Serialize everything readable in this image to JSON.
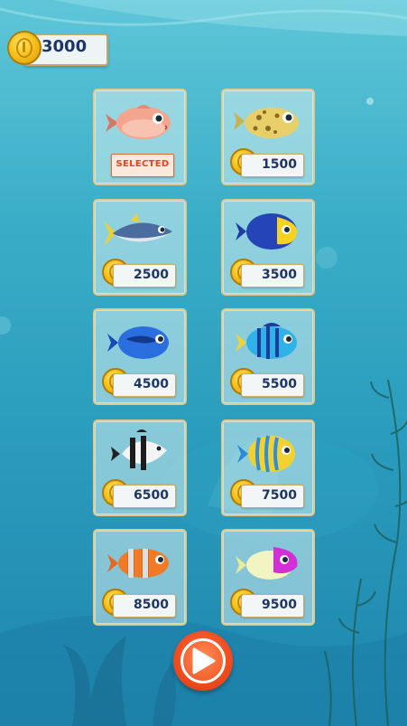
{
  "balance": {
    "coins": "3000"
  },
  "shop": {
    "selected_label": "SELECTED",
    "items": [
      {
        "fish": "pink-puffer-fish",
        "price": "",
        "status": "selected"
      },
      {
        "fish": "spotted-boxfish",
        "price": "1500",
        "status": "locked"
      },
      {
        "fish": "tuna-fish",
        "price": "2500",
        "status": "locked"
      },
      {
        "fish": "blue-yellow-tang-fish",
        "price": "3500",
        "status": "locked"
      },
      {
        "fish": "blue-tang-fish",
        "price": "4500",
        "status": "locked"
      },
      {
        "fish": "striped-blue-fish",
        "price": "5500",
        "status": "locked"
      },
      {
        "fish": "moorish-idol-fish",
        "price": "6500",
        "status": "locked"
      },
      {
        "fish": "striped-angelfish",
        "price": "7500",
        "status": "locked"
      },
      {
        "fish": "clownfish",
        "price": "8500",
        "status": "locked"
      },
      {
        "fish": "magenta-fish",
        "price": "9500",
        "status": "locked"
      }
    ]
  },
  "play": {
    "icon": "play-icon"
  },
  "colors": {
    "accent": "#f04b1e",
    "price_text": "#1c3566",
    "selected_text": "#e8431a",
    "card_border": "#e3c98a"
  }
}
